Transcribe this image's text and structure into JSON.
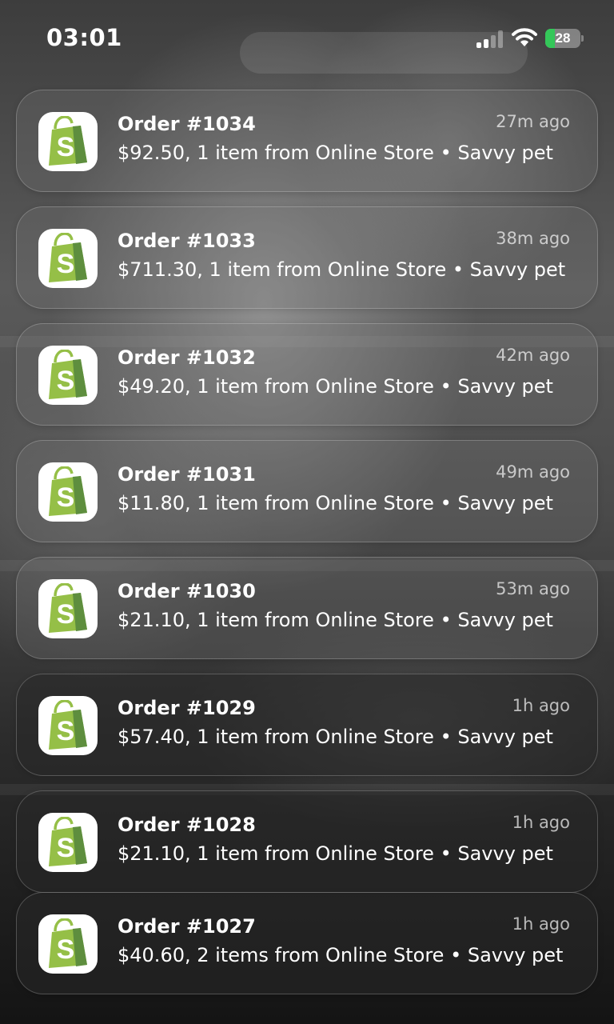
{
  "status_bar": {
    "time": "03:01",
    "battery_percent": "28",
    "battery_level": 0.28,
    "battery_charging": true,
    "signal_bars_active": 2,
    "signal_bars_total": 4,
    "icons": [
      "cellular-signal-icon",
      "wifi-icon",
      "battery-icon"
    ]
  },
  "notifications": [
    {
      "app": "Shopify",
      "app_icon": "shopify-bag-icon",
      "title": "Order #1034",
      "time": "27m ago",
      "body": "$92.50, 1 item from Online Store • Savvy pet"
    },
    {
      "app": "Shopify",
      "app_icon": "shopify-bag-icon",
      "title": "Order #1033",
      "time": "38m ago",
      "body": "$711.30, 1 item from Online Store • Savvy pet"
    },
    {
      "app": "Shopify",
      "app_icon": "shopify-bag-icon",
      "title": "Order #1032",
      "time": "42m ago",
      "body": "$49.20, 1 item from Online Store • Savvy pet"
    },
    {
      "app": "Shopify",
      "app_icon": "shopify-bag-icon",
      "title": "Order #1031",
      "time": "49m ago",
      "body": "$11.80, 1 item from Online Store • Savvy pet"
    },
    {
      "app": "Shopify",
      "app_icon": "shopify-bag-icon",
      "title": "Order #1030",
      "time": "53m ago",
      "body": "$21.10, 1 item from Online Store • Savvy pet"
    },
    {
      "app": "Shopify",
      "app_icon": "shopify-bag-icon",
      "title": "Order #1029",
      "time": "1h ago",
      "body": "$57.40, 1 item from Online Store • Savvy pet"
    },
    {
      "app": "Shopify",
      "app_icon": "shopify-bag-icon",
      "title": "Order #1028",
      "time": "1h ago",
      "body": "$21.10, 1 item from Online Store • Savvy pet"
    },
    {
      "app": "Shopify",
      "app_icon": "shopify-bag-icon",
      "title": "Order #1027",
      "time": "1h ago",
      "body": "$40.60, 2 items from Online Store • Savvy pet"
    }
  ],
  "colors": {
    "shopify_green": "#95bf47",
    "shopify_green_dark": "#5e8e3e",
    "battery_green": "#34c759",
    "text_primary": "#ffffff",
    "text_secondary": "#b4b4b4"
  }
}
